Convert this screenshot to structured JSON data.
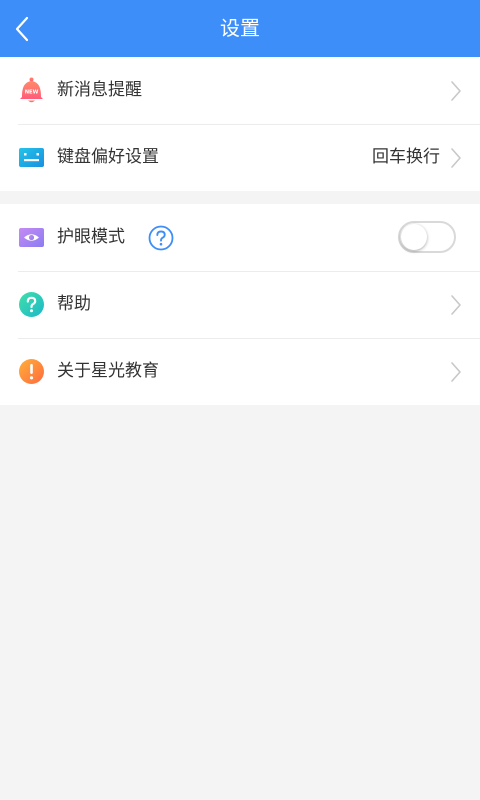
{
  "header": {
    "title": "设置",
    "back_icon": "chevron-left-icon"
  },
  "colors": {
    "header_bg": "#3d8ef8",
    "page_bg": "#f4f4f4",
    "help_icon": "#3d8ef8"
  },
  "settings": {
    "new_message": {
      "label": "新消息提醒",
      "icon": "bell-new-icon",
      "badge": "NEW"
    },
    "keyboard": {
      "label": "键盘偏好设置",
      "icon": "keyboard-icon",
      "value": "回车换行"
    },
    "eye_mode": {
      "label": "护眼模式",
      "icon": "eye-icon",
      "help_icon": "question-circle-icon",
      "enabled": false
    },
    "help": {
      "label": "帮助",
      "icon": "question-icon"
    },
    "about": {
      "label": "关于星光教育",
      "icon": "exclamation-icon"
    }
  }
}
